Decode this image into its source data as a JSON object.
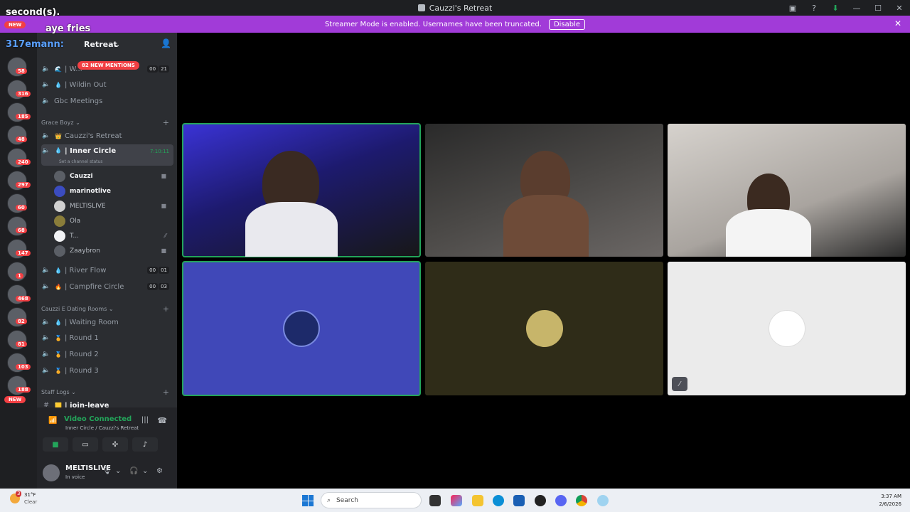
{
  "window": {
    "title": "Cauzzi's Retreat"
  },
  "banner": {
    "text": "Streamer Mode is enabled. Usernames have been truncated.",
    "disable_label": "Disable"
  },
  "stream_overlay": {
    "line1": "second(s).",
    "line2": "aye fries",
    "line3": "317emann:"
  },
  "guild_badges": [
    "58",
    "316",
    "185",
    "48",
    "240",
    "297",
    "60",
    "68",
    "147",
    "1",
    "468",
    "82",
    "81",
    "103",
    "188"
  ],
  "guild_new_labels": [
    "NEW",
    "NEW"
  ],
  "sidebar": {
    "server_name": "Retreat",
    "new_mentions": "82 NEW MENTIONS",
    "channels_top": [
      {
        "name": "| W...",
        "emoji": "🌊",
        "count": [
          "00",
          "21"
        ]
      },
      {
        "name": "| Wildin Out",
        "emoji": "💧"
      },
      {
        "name": "Gbc Meetings",
        "emoji": ""
      }
    ],
    "category_grace": "Grace Boyz",
    "channels_grace": [
      {
        "name": "Cauzzi's Retreat",
        "emoji": "👑"
      },
      {
        "name": "| Inner Circle",
        "emoji": "💧",
        "timer": "7:10:11",
        "status": "Set a channel status"
      }
    ],
    "voice_users": [
      {
        "name": "Cauzzi",
        "icon": "camera-icon"
      },
      {
        "name": "marinotlive",
        "icon": ""
      },
      {
        "name": "MELTISLIVE",
        "icon": "camera-icon"
      },
      {
        "name": "Ola",
        "icon": ""
      },
      {
        "name": "T...",
        "icon": "mic-muted-icon"
      },
      {
        "name": "Zaaybron",
        "icon": "camera-icon"
      }
    ],
    "channels_more": [
      {
        "name": "| River Flow",
        "emoji": "💧",
        "count": [
          "00",
          "01"
        ]
      },
      {
        "name": "| Campfire Circle",
        "emoji": "🔥",
        "count": [
          "00",
          "03"
        ]
      }
    ],
    "category_dating": "Cauzzi E Dating Rooms",
    "channels_dating": [
      {
        "name": "| Waiting Room",
        "emoji": "💧"
      },
      {
        "name": "| Round 1",
        "emoji": "🏅"
      },
      {
        "name": "| Round 2",
        "emoji": "🏅"
      },
      {
        "name": "| Round 3",
        "emoji": "🏅"
      }
    ],
    "category_staff": "Staff Logs",
    "channel_staff": "| join-leave"
  },
  "rtc": {
    "status": "Video Connected",
    "location": "Inner Circle / Cauzzi's Retreat"
  },
  "user_panel": {
    "name": "MELTISLIVE",
    "status": "In voice"
  },
  "taskbar": {
    "temp": "31°F",
    "condition": "Clear",
    "search_placeholder": "Search",
    "time": "3:37 AM",
    "date": "2/6/2026",
    "weather_badge": "3"
  },
  "colors": {
    "accent_green": "#23a55a",
    "banner_purple": "#a13bd8",
    "mention_red": "#f23f43",
    "tile_blue": "#4048b8",
    "tile_olive": "#2f2c18",
    "tile_light": "#ebebeb"
  }
}
